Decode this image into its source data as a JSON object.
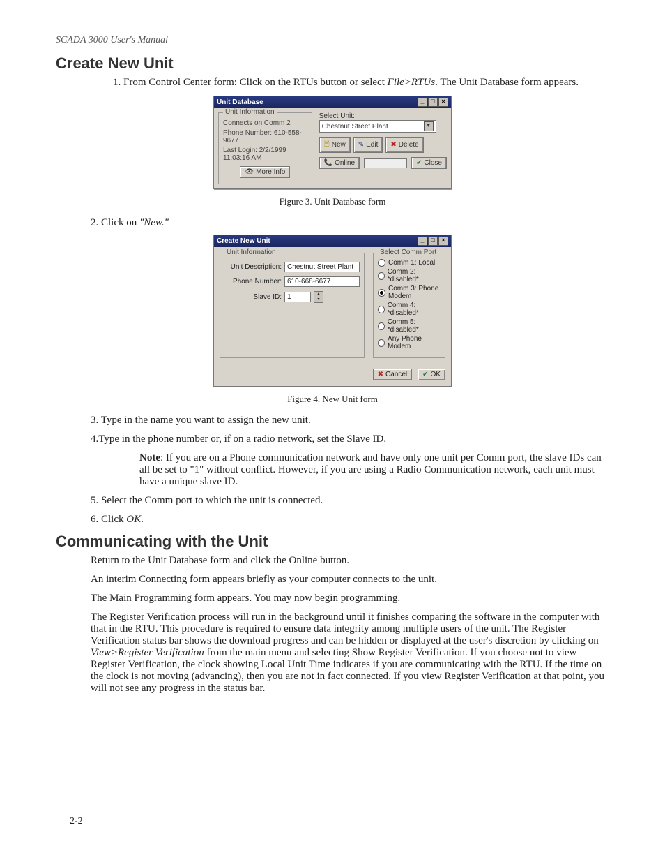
{
  "header": {
    "running": "SCADA 3000 User's Manual"
  },
  "sections": {
    "create": "Create New Unit",
    "comm": "Communicating with the Unit"
  },
  "steps": {
    "s1a": "1. From Control Center form: Click on the RTUs button or select ",
    "s1b": "File>RTUs",
    "s1c": ". The Unit Database form appears.",
    "s2a": "2. Click on ",
    "s2b": "\"New.\"",
    "s3": "3. Type in the name you want to assign the new unit.",
    "s4": "4.Type in the phone number or, if on a radio network, set the Slave ID.",
    "noteLabel": "Note",
    "noteBody": ": If you are on a Phone communication network and have only one unit per Comm port, the slave IDs can all be set to \"1\" without conflict.  However, if you are using a Radio Communication network, each unit must have a unique slave ID.",
    "s5": "5. Select the Comm port to which the unit is connected.",
    "s6a": "6. Click ",
    "s6b": "OK",
    "s6c": "."
  },
  "captions": {
    "fig3": "Figure 3. Unit Database form",
    "fig4": "Figure 4. New Unit form"
  },
  "comm": {
    "p1": "Return to the Unit Database form and click the Online button.",
    "p2": "An interim Connecting form appears briefly as your computer connects to the unit.",
    "p3": "The Main Programming form appears. You may now begin programming.",
    "p4a": "The Register Verification process will run in the background until it finishes comparing the software in the computer with that in the RTU. This procedure is required to ensure data integrity among multiple users of the unit. The Register Verification status bar shows the download progress and can be hidden or displayed at the user's discretion by clicking on ",
    "p4b": "View>Register Verification",
    "p4c": " from the main menu and selecting Show Register Verification. If you choose not to view Register Verification, the clock showing Local Unit Time indicates if you are communicating with the RTU.  If the time on the clock is not moving (advancing), then you are not in fact connected. If you view Register Verification at that point, you will not see any progress in the status bar."
  },
  "pagenum": "2-2",
  "fig3win": {
    "title": "Unit Database",
    "group": "Unit Information",
    "connects": "Connects on Comm 2",
    "phone": "Phone Number:  610-558-9677",
    "lastlogin": "Last Login: 2/2/1999 11:03:16 AM",
    "moreinfo": "More Info",
    "selectLabel": "Select Unit:",
    "selectValue": "Chestnut Street Plant",
    "newBtn": "New",
    "editBtn": "Edit",
    "deleteBtn": "Delete",
    "online": "Online",
    "close": "Close"
  },
  "fig4win": {
    "title": "Create New Unit",
    "group": "Unit Information",
    "descLabel": "Unit Description:",
    "descVal": "Chestnut Street Plant",
    "phoneLabel": "Phone Number:",
    "phoneVal": "610-668-6677",
    "slaveLabel": "Slave ID:",
    "slaveVal": "1",
    "portGroup": "Select Comm Port",
    "p1": "Comm 1: Local",
    "p2": "Comm 2: *disabled*",
    "p3": "Comm 3: Phone Modem",
    "p4": "Comm 4: *disabled*",
    "p5": "Comm 5: *disabled*",
    "p6": "Any Phone Modem",
    "cancel": "Cancel",
    "ok": "OK"
  }
}
